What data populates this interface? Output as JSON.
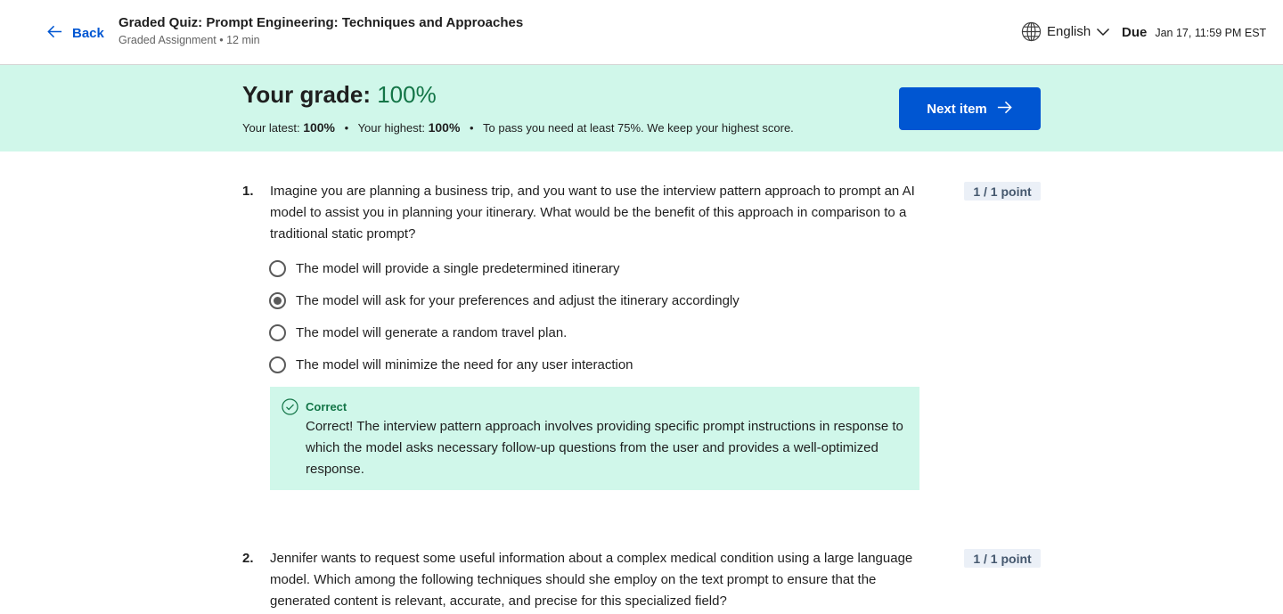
{
  "header": {
    "back_label": "Back",
    "title": "Graded Quiz: Prompt Engineering: Techniques and Approaches",
    "subtitle": "Graded Assignment • 12 min",
    "language": "English",
    "due_label": "Due",
    "due_date": "Jan 17, 11:59 PM EST"
  },
  "banner": {
    "grade_label": "Your grade: ",
    "grade_value": "100%",
    "latest_label": "Your latest: ",
    "latest_value": "100%",
    "highest_label": "Your highest: ",
    "highest_value": "100%",
    "pass_note": "To pass you need at least 75%. We keep your highest score.",
    "next_label": "Next item",
    "accent_color": "#137547",
    "background_color": "#d0f7ea"
  },
  "questions": [
    {
      "number": "1.",
      "text": "Imagine you are planning a business trip, and you want to use the interview pattern approach to prompt an AI model to assist you in planning your itinerary. What would be the benefit of this approach in comparison to a traditional static prompt?",
      "points": "1 / 1 point",
      "options": [
        "The model will provide a single predetermined itinerary",
        "The model will ask for your preferences and adjust the itinerary accordingly",
        "The model will generate a random travel plan.",
        "The model will minimize the need for any user interaction"
      ],
      "selected_index": 1,
      "feedback": {
        "title": "Correct",
        "text": "Correct! The interview pattern approach involves providing specific prompt instructions in response to which the model asks necessary follow-up questions from the user and provides a well-optimized response."
      }
    },
    {
      "number": "2.",
      "text": "Jennifer wants to request some useful information about a complex medical condition using a large language model. Which among the following techniques should she employ on the text prompt to ensure that the generated content is relevant, accurate, and precise for this specialized field?",
      "points": "1 / 1 point"
    }
  ],
  "icons": {
    "back": "arrow-left-icon",
    "language": "globe-icon",
    "dropdown": "chevron-down-icon",
    "next": "arrow-right-icon",
    "correct": "check-circle-icon"
  },
  "colors": {
    "primary": "#0056d2",
    "success": "#137547"
  }
}
